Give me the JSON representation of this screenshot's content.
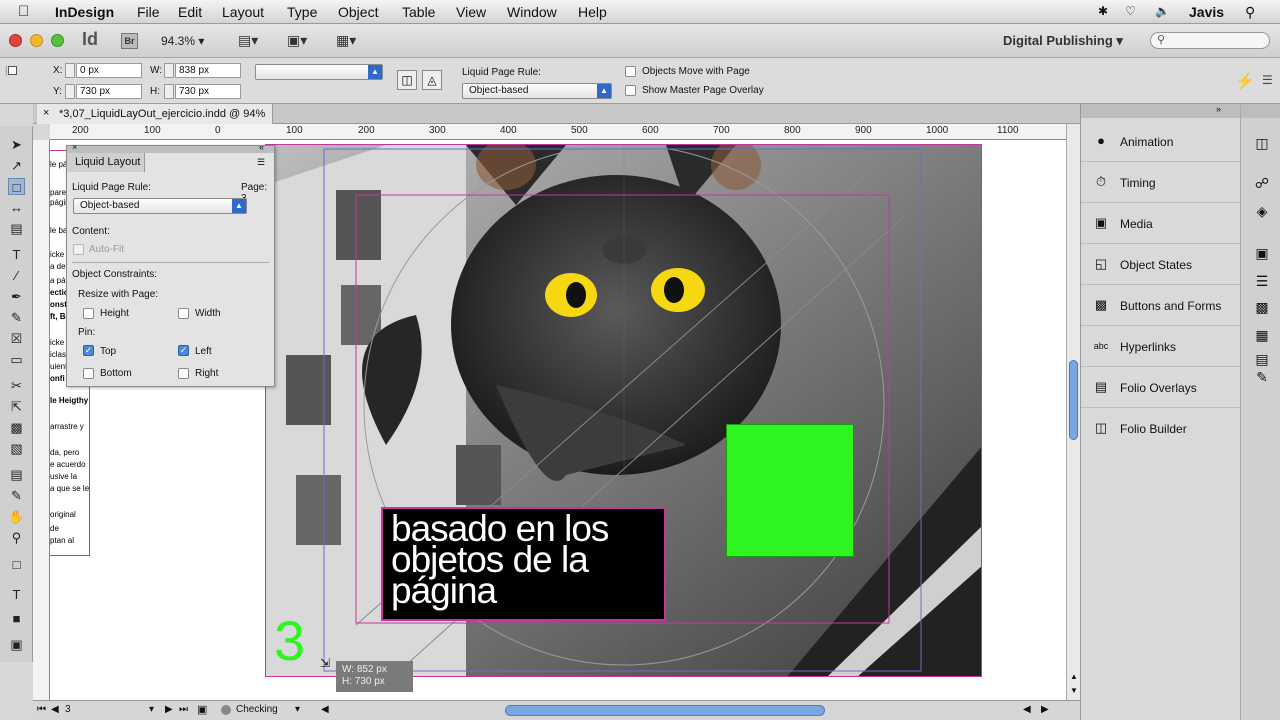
{
  "menubar": {
    "app": "InDesign",
    "items": [
      "File",
      "Edit",
      "Layout",
      "Type",
      "Object",
      "Table",
      "View",
      "Window",
      "Help"
    ],
    "user": "Javis"
  },
  "appbar": {
    "logo": "Id",
    "bridge": "Br",
    "zoom": "94.3%",
    "workspace": "Digital Publishing",
    "search_placeholder": ""
  },
  "control": {
    "x_label": "X:",
    "x_value": "0 px",
    "y_label": "Y:",
    "y_value": "730 px",
    "w_label": "W:",
    "w_value": "838 px",
    "h_label": "H:",
    "h_value": "730 px",
    "lpr_label": "Liquid Page Rule:",
    "lpr_value": "Object-based",
    "objects_move": "Objects Move with Page",
    "master_overlay": "Show Master Page Overlay"
  },
  "doc": {
    "tab_title": "*3,07_LiquidLayOut_ejercicio.indd @ 94%",
    "ruler_ticks": [
      "200",
      "100",
      "0",
      "100",
      "200",
      "300",
      "400",
      "500",
      "600",
      "700",
      "800",
      "900",
      "1000",
      "1100"
    ]
  },
  "liquid_panel": {
    "title": "Liquid Layout",
    "rule_label": "Liquid Page Rule:",
    "page_label": "Page: 3",
    "rule_value": "Object-based",
    "content_label": "Content:",
    "autofit": "Auto-Fit",
    "constraints_label": "Object Constraints:",
    "resize_label": "Resize with Page:",
    "height": "Height",
    "width": "Width",
    "pin_label": "Pin:",
    "top": "Top",
    "left": "Left",
    "bottom": "Bottom",
    "right": "Right",
    "top_checked": true,
    "left_checked": true
  },
  "page": {
    "headline": [
      "basado en los",
      "objetos de la",
      "página"
    ],
    "page_number": "3",
    "size_w": "W: 852 px",
    "size_h": "H: 730 px",
    "green": "#2ef51f"
  },
  "margin_notes": [
    "le pá",
    "pareci",
    "págin",
    "le ba",
    "icke",
    "a de",
    "a pá",
    "ectio",
    "onst",
    "ft, Be",
    "icke",
    "iclas",
    "uient",
    "onfi",
    "le Heigthy",
    "arrastre y",
    "da, pero",
    "e acuerdo",
    "usive la",
    "a que se le",
    "original",
    "de",
    "ptan al"
  ],
  "status": {
    "page": "3",
    "checking": "Checking"
  },
  "panels": [
    {
      "icon": "animation-icon",
      "label": "Animation"
    },
    {
      "icon": "timing-icon",
      "label": "Timing"
    },
    {
      "icon": "media-icon",
      "label": "Media"
    },
    {
      "icon": "object-states-icon",
      "label": "Object States"
    },
    {
      "icon": "buttons-forms-icon",
      "label": "Buttons and Forms"
    },
    {
      "icon": "hyperlinks-icon",
      "label": "Hyperlinks"
    },
    {
      "icon": "folio-overlays-icon",
      "label": "Folio Overlays"
    },
    {
      "icon": "folio-builder-icon",
      "label": "Folio Builder"
    }
  ]
}
